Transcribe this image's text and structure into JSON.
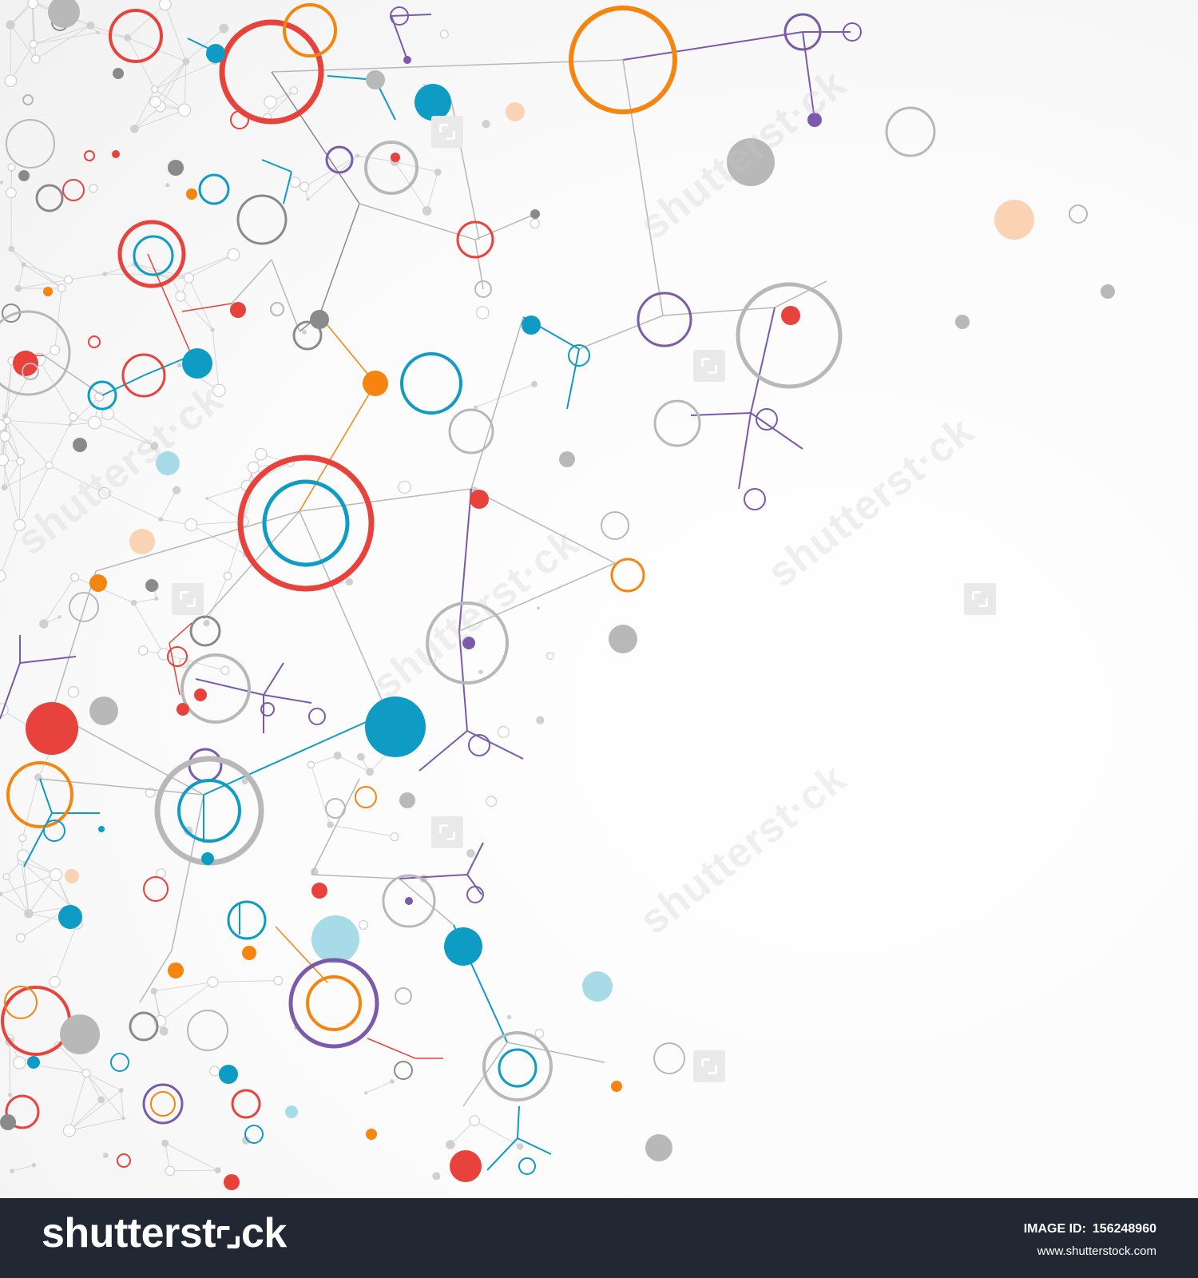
{
  "artwork": {
    "subject": "abstract colorful network / molecular connection graphic",
    "palette": {
      "red": "#e8423c",
      "orange": "#f5850f",
      "blue": "#0e9bc4",
      "purple": "#7b5aab",
      "gray": "#b8b8b8",
      "dark_gray": "#8a8a8a",
      "light_blue": "#a6dbe7",
      "peach": "#fad3b4",
      "background": "#f7f7f7"
    }
  },
  "watermark": {
    "text_fragment": "shutterst",
    "text_suffix": "ck"
  },
  "footer": {
    "brand_left": "shutterst",
    "brand_right": "ck",
    "image_id_label": "IMAGE ID:",
    "image_id_value": "156248960",
    "site": "www.shutterstock.com",
    "background": "#222833"
  }
}
